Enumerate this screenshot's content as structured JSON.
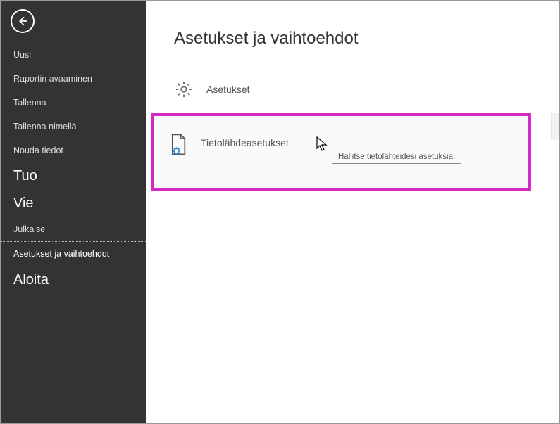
{
  "sidebar": {
    "items": [
      {
        "label": "Uusi",
        "style": "small"
      },
      {
        "label": "Raportin avaaminen",
        "style": "small"
      },
      {
        "label": "Tallenna",
        "style": "small"
      },
      {
        "label": "Tallenna nimellä",
        "style": "small"
      },
      {
        "label": "Nouda tiedot",
        "style": "small"
      },
      {
        "label": "Tuo",
        "style": "big"
      },
      {
        "label": "Vie",
        "style": "big"
      },
      {
        "label": "Julkaise",
        "style": "small"
      },
      {
        "label": "Asetukset ja vaihtoehdot",
        "style": "small",
        "selected": true
      },
      {
        "label": "Aloita",
        "style": "big"
      }
    ]
  },
  "main": {
    "title": "Asetukset ja vaihtoehdot",
    "options": {
      "settings_label": "Asetukset",
      "datasource_label": "Tietolähdeasetukset"
    },
    "tooltip": "Hallitse tietolähteidesi asetuksia."
  }
}
